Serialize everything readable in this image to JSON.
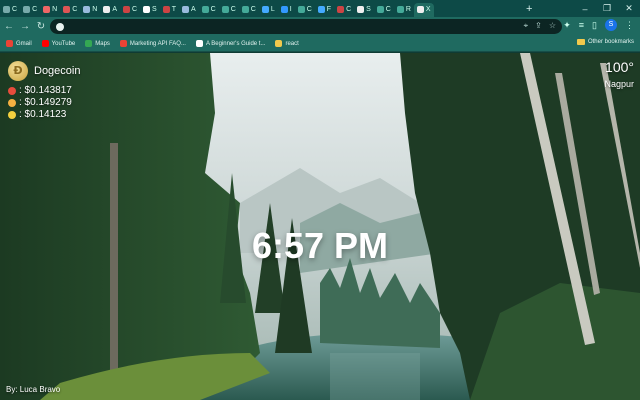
{
  "browser": {
    "tabs": [
      {
        "label": "C",
        "color": "#7aa"
      },
      {
        "label": "C",
        "color": "#7aa"
      },
      {
        "label": "N",
        "color": "#e66"
      },
      {
        "label": "C",
        "color": "#d55"
      },
      {
        "label": "N",
        "color": "#9bd"
      },
      {
        "label": "A",
        "color": "#eee"
      },
      {
        "label": "C",
        "color": "#c44"
      },
      {
        "label": "S",
        "color": "#fff"
      },
      {
        "label": "T",
        "color": "#c44"
      },
      {
        "label": "A",
        "color": "#9bd"
      },
      {
        "label": "C",
        "color": "#4a9"
      },
      {
        "label": "C",
        "color": "#4a9"
      },
      {
        "label": "C",
        "color": "#4a9"
      },
      {
        "label": "L",
        "color": "#4af"
      },
      {
        "label": "I",
        "color": "#39f"
      },
      {
        "label": "C",
        "color": "#4a9"
      },
      {
        "label": "F",
        "color": "#4af"
      },
      {
        "label": "C",
        "color": "#c44"
      },
      {
        "label": "S",
        "color": "#eee"
      },
      {
        "label": "C",
        "color": "#4a9"
      },
      {
        "label": "R",
        "color": "#4a9"
      },
      {
        "label": "X",
        "color": "#eee",
        "active": true
      }
    ],
    "new_tab": "+",
    "window_controls": {
      "minimize": "–",
      "restore": "❐",
      "close": "✕"
    },
    "nav": {
      "back": "←",
      "forward": "→",
      "reload": "↻"
    },
    "omnibox": {
      "value": ""
    },
    "profile_initial": "S",
    "bookmarks": [
      {
        "label": "Gmail",
        "color": "#ea4335"
      },
      {
        "label": "YouTube",
        "color": "#ff0000"
      },
      {
        "label": "Maps",
        "color": "#34a853"
      },
      {
        "label": "Marketing API FAQ...",
        "color": "#ea4335"
      },
      {
        "label": "A Beginner's Guide t...",
        "color": "#ffffff"
      },
      {
        "label": "react",
        "color": "#f2c94c"
      }
    ],
    "other_bookmarks": "Other bookmarks"
  },
  "newtab": {
    "crypto": {
      "name": "Dogecoin",
      "coin_symbol": "Ð",
      "prices": [
        {
          "label": ": $0.143817",
          "icon_color": "#e74c3c"
        },
        {
          "label": ": $0.149279",
          "icon_color": "#f5b041"
        },
        {
          "label": ": $0.14123",
          "icon_color": "#f4d03f"
        }
      ]
    },
    "weather": {
      "temp": "100°",
      "city": "Nagpur"
    },
    "clock": "6:57 PM",
    "credit": "By: Luca Bravo"
  }
}
